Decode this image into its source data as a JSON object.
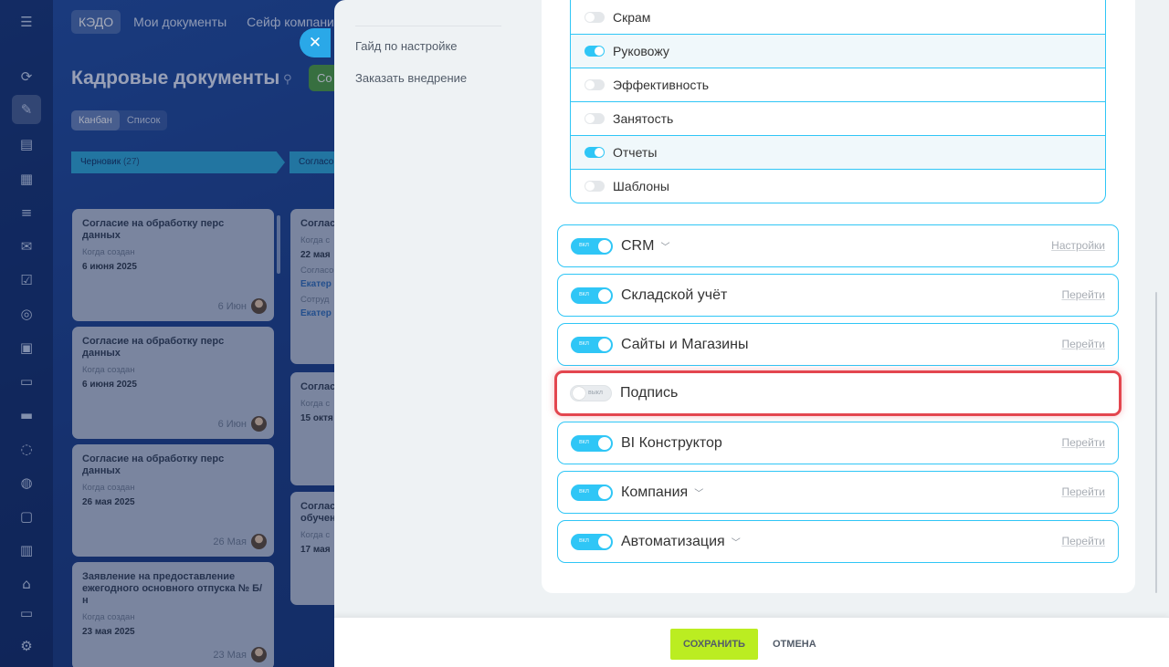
{
  "background": {
    "top_nav": [
      "КЭДО",
      "Мои документы",
      "Сейф компании"
    ],
    "page_title": "Кадровые документы",
    "create_button": "Со",
    "view_switch": [
      "Канбан",
      "Список"
    ],
    "columns": [
      {
        "label": "Черновик",
        "count": "(27)"
      },
      {
        "label": "Согласо"
      }
    ],
    "cards": [
      {
        "title": "Согласие на обработку перс данных",
        "date_label": "Когда создан",
        "date": "6 июня 2025",
        "foot": "6 Июн"
      },
      {
        "title": "Согласие на обработку перс данных",
        "date_label": "Когда создан",
        "date": "6 июня 2025",
        "foot": "6 Июн"
      },
      {
        "title": "Согласие на обработку перс данных",
        "date_label": "Когда создан",
        "date": "26 мая 2025",
        "foot": "26 Мая"
      },
      {
        "title": "Заявление на предоставление ежегодного основного отпуска № Б/н",
        "date_label": "Когда создан",
        "date": "23 мая 2025",
        "foot": "23 Мая"
      }
    ],
    "cards_col2": [
      {
        "title": "Соглас",
        "lbl1": "Когда с",
        "date": "22 мая",
        "lbl2": "Согласо",
        "link1": "Екатер",
        "lbl3": "Сотруд",
        "link2": "Екатер"
      },
      {
        "title": "Соглас",
        "lbl1": "Когда с",
        "date": "15 октя"
      },
      {
        "title": "Соглас обучен",
        "lbl1": "Когда с",
        "date": "17 мая"
      }
    ]
  },
  "panel": {
    "sidebar_links": [
      "Гайд по настройке",
      "Заказать внедрение"
    ],
    "sub_modules": [
      {
        "label": "Скрам",
        "on": false
      },
      {
        "label": "Руковожу",
        "on": true
      },
      {
        "label": "Эффективность",
        "on": false
      },
      {
        "label": "Занятость",
        "on": false
      },
      {
        "label": "Отчеты",
        "on": true
      },
      {
        "label": "Шаблоны",
        "on": false
      }
    ],
    "toggle_on_label": "вкл",
    "toggle_off_label": "выкл",
    "modules": [
      {
        "name": "CRM",
        "on": true,
        "chevron": true,
        "link": "Настройки"
      },
      {
        "name": "Складской учёт",
        "on": true,
        "chevron": false,
        "link": "Перейти"
      },
      {
        "name": "Сайты и Магазины",
        "on": true,
        "chevron": false,
        "link": "Перейти"
      },
      {
        "name": "Подпись",
        "on": false,
        "chevron": false,
        "link": "",
        "highlighted": true
      },
      {
        "name": "BI Конструктор",
        "on": true,
        "chevron": false,
        "link": "Перейти"
      },
      {
        "name": "Компания",
        "on": true,
        "chevron": true,
        "link": "Перейти"
      },
      {
        "name": "Автоматизация",
        "on": true,
        "chevron": true,
        "link": "Перейти"
      }
    ],
    "footer": {
      "save": "Сохранить",
      "cancel": "Отмена"
    }
  },
  "colors": {
    "accent": "#2fc6f6",
    "save": "#bbed21",
    "highlight": "#e3464f"
  },
  "icons": [
    "hamburger-icon",
    "close-icon",
    "pin-icon",
    "chevron-down-icon"
  ]
}
